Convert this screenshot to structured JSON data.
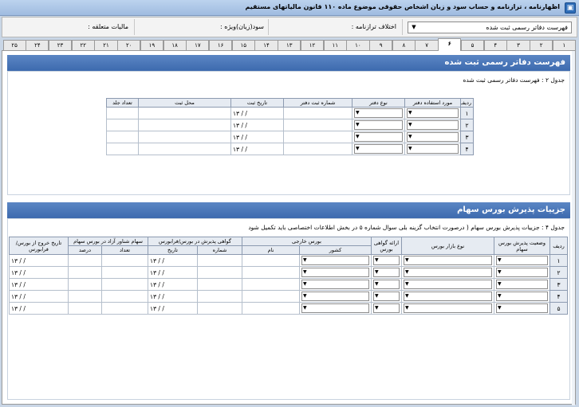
{
  "window": {
    "title": "اظهارنامه ، ترازنامه و حساب سود و زیان اشخاص حقوقی موضوع ماده ۱۱۰ قانون مالیاتهای مستقیم",
    "icon": "app-icon"
  },
  "topbar": {
    "select_value": "فهرست دفاتر رسمی ثبت شده",
    "discrepancy_label": "اختلاف ترازنامه :",
    "special_label": "سود(زیان)ویژه :",
    "tax_label": "مالیات متعلقه :"
  },
  "tabs": [
    "۱",
    "۲",
    "۳",
    "۴",
    "۵",
    "۶",
    "۷",
    "۸",
    "۹",
    "۱۰",
    "۱۱",
    "۱۲",
    "۱۳",
    "۱۴",
    "۱۵",
    "۱۶",
    "۱۷",
    "۱۸",
    "۱۹",
    "۲۰",
    "۲۱",
    "۲۲",
    "۲۳",
    "۲۴",
    "۲۵"
  ],
  "active_tab": "۶",
  "section1": {
    "title": "فهرست دفاتر رسمی ثبت شده",
    "caption": "جدول ۲ : فهرست دفاتر رسمی ثبت شده",
    "headers": [
      "ردیف",
      "مورد استفاده دفتر",
      "نوع دفتر",
      "شماره ثبت دفتر",
      "تاریخ ثبت",
      "محل ثبت",
      "تعداد جلد"
    ],
    "rows": [
      {
        "num": "۱",
        "date": "۱۳ / /"
      },
      {
        "num": "۲",
        "date": "۱۳ / /"
      },
      {
        "num": "۳",
        "date": "۱۳ / /"
      },
      {
        "num": "۴",
        "date": "۱۳ / /"
      }
    ]
  },
  "section2": {
    "title": "جزییات پذیرش بورس سهام",
    "caption": "جدول ۴ : جزییات پذیرش بورس سهام ( درصورت انتخاب گزینه بلی سوال شماره ۵ در بخش اطلاعات اختصاصی باید تکمیل شود",
    "headers": {
      "row": "ردیف",
      "status": "وضعیت پذیرش بورس سهام",
      "market": "نوع بازار بورس",
      "cert": "ارائه گواهی بورس",
      "foreign": "بورس خارجی",
      "country": "کشور",
      "name": "نام",
      "acceptance": "گواهی پذیرش در بورس/فرابورس",
      "number": "شماره",
      "date": "تاریخ",
      "float": "سهام شناور آزاد در بورس سهام",
      "count": "تعداد",
      "percent": "درصد",
      "exit": "تاریخ خروج از بورس/فرابورس"
    },
    "rows": [
      {
        "num": "۱",
        "date": "۱۳ / /",
        "exit": "۱۳ / /"
      },
      {
        "num": "۲",
        "date": "۱۳ / /",
        "exit": "۱۳ / /"
      },
      {
        "num": "۳",
        "date": "۱۳ / /",
        "exit": "۱۳ / /"
      },
      {
        "num": "۴",
        "date": "۱۳ / /",
        "exit": "۱۳ / /"
      },
      {
        "num": "۵",
        "date": "۱۳ / /",
        "exit": "۱۳ / /"
      }
    ]
  }
}
